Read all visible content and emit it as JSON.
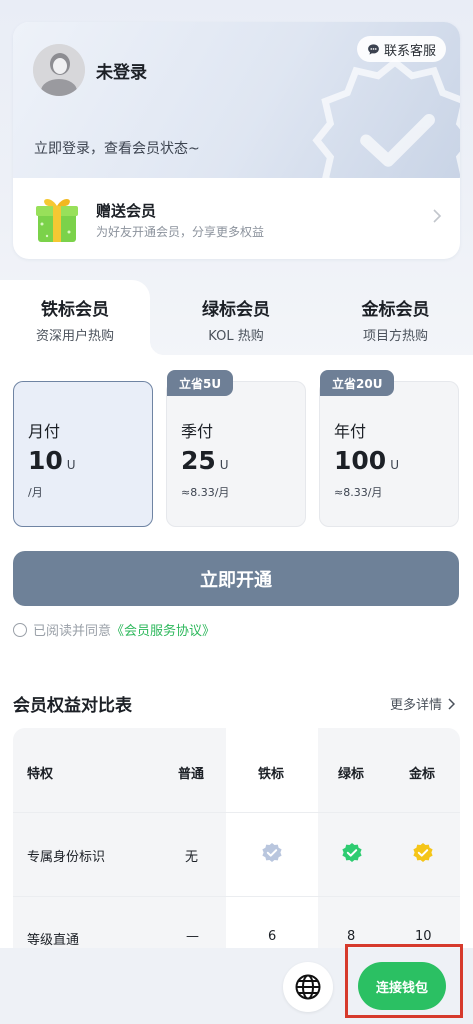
{
  "profile": {
    "nickname": "未登录",
    "service_label": "联系客服",
    "login_tip": "立即登录，查看会员状态~"
  },
  "gift": {
    "title": "赠送会员",
    "subtitle": "为好友开通会员，分享更多权益"
  },
  "tabs": [
    {
      "name": "铁标会员",
      "sub": "资深用户热购"
    },
    {
      "name": "绿标会员",
      "sub": "KOL 热购"
    },
    {
      "name": "金标会员",
      "sub": "项目方热购"
    }
  ],
  "plans": [
    {
      "name": "月付",
      "price": "10",
      "unit": "U",
      "per": "/月",
      "tag": ""
    },
    {
      "name": "季付",
      "price": "25",
      "unit": "U",
      "per": "≈8.33/月",
      "tag": "立省5U"
    },
    {
      "name": "年付",
      "price": "100",
      "unit": "U",
      "per": "≈8.33/月",
      "tag": "立省20U"
    }
  ],
  "open_button": "立即开通",
  "agreement": {
    "text": "已阅读并同意",
    "link": "《会员服务协议》"
  },
  "benefits": {
    "title": "会员权益对比表",
    "more": "更多详情",
    "headers": [
      "特权",
      "普通",
      "铁标",
      "绿标",
      "金标"
    ],
    "rows": [
      {
        "name": "专属身份标识",
        "normal": "无"
      },
      {
        "name": "等级直通",
        "normal": "—",
        "iron": "6",
        "green": "8",
        "gold": "10"
      }
    ]
  },
  "colors": {
    "accent_green": "#2bc063",
    "button_slate": "#6e8198",
    "iron_mark": "#b9c6de",
    "green_mark": "#2ecc71",
    "gold_mark": "#f5c518",
    "highlight_frame": "#d63a2c"
  },
  "bottom": {
    "globe_icon": "globe-icon",
    "wallet_label": "连接钱包"
  }
}
